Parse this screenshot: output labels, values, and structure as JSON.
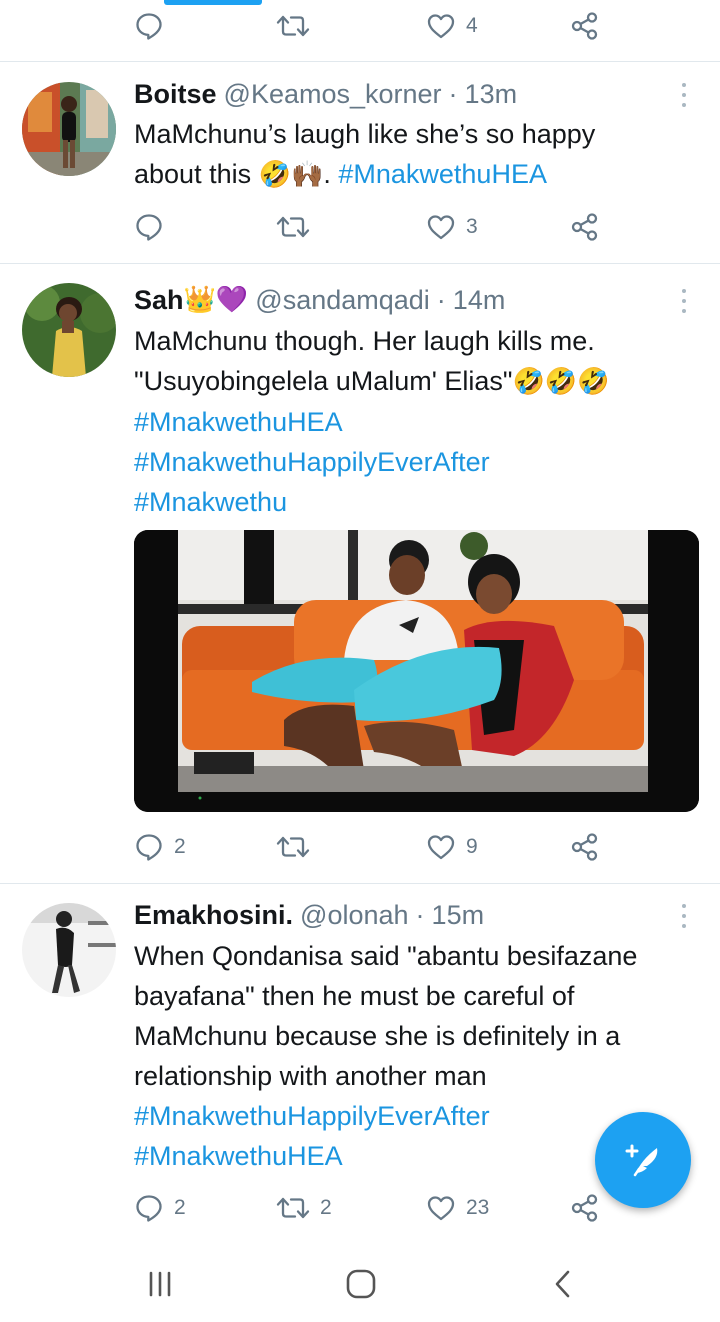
{
  "colors": {
    "accent": "#1da1f2",
    "hashtag": "#1b95e0",
    "secondary_text": "#657786",
    "divider": "#e1e8ed"
  },
  "top_actions": {
    "reply_count": "",
    "retweet_count": "",
    "like_count": "4"
  },
  "tweets": [
    {
      "name": "Boitse",
      "handle": "@Keamos_korner",
      "separator": "·",
      "time": "13m",
      "text_lines": [
        "MaMchunu’s laugh like she’s so happy",
        "about this "
      ],
      "emoji": "🤣🙌🏾",
      "after_emoji": ". ",
      "hashtags": [
        "#MnakwethuHEA"
      ],
      "reply_count": "",
      "retweet_count": "",
      "like_count": "3"
    },
    {
      "name": "Sah",
      "name_emoji": "👑💜",
      "handle": "@sandamqadi",
      "separator": "·",
      "time": "14m",
      "text_lines": [
        "MaMchunu though. Her laugh kills me.",
        "\"Usuyobingelela uMalum' Elias\""
      ],
      "emoji": "🤣🤣🤣",
      "hashtags": [
        "#MnakwethuHEA",
        "#MnakwethuHappilyEverAfter",
        "#Mnakwethu"
      ],
      "reply_count": "2",
      "retweet_count": "",
      "like_count": "9"
    },
    {
      "name": "Emakhosini.",
      "handle": "@olonah",
      "separator": "·",
      "time": "15m",
      "text_lines": [
        "When Qondanisa said \"abantu besifazane",
        "bayafana\" then he must be careful of",
        "MaMchunu because she is definitely in a",
        "relationship with another man"
      ],
      "hashtags": [
        "#MnakwethuHappilyEverAfter",
        "#MnakwethuHEA"
      ],
      "reply_count": "2",
      "retweet_count": "2",
      "like_count": "23"
    }
  ],
  "icons": {
    "reply": "reply-icon",
    "retweet": "retweet-icon",
    "like": "heart-icon",
    "share": "share-icon",
    "more": "more-vertical-icon",
    "compose": "compose-tweet-icon",
    "nav_recents": "recents-icon",
    "nav_home": "home-icon",
    "nav_back": "back-icon"
  }
}
